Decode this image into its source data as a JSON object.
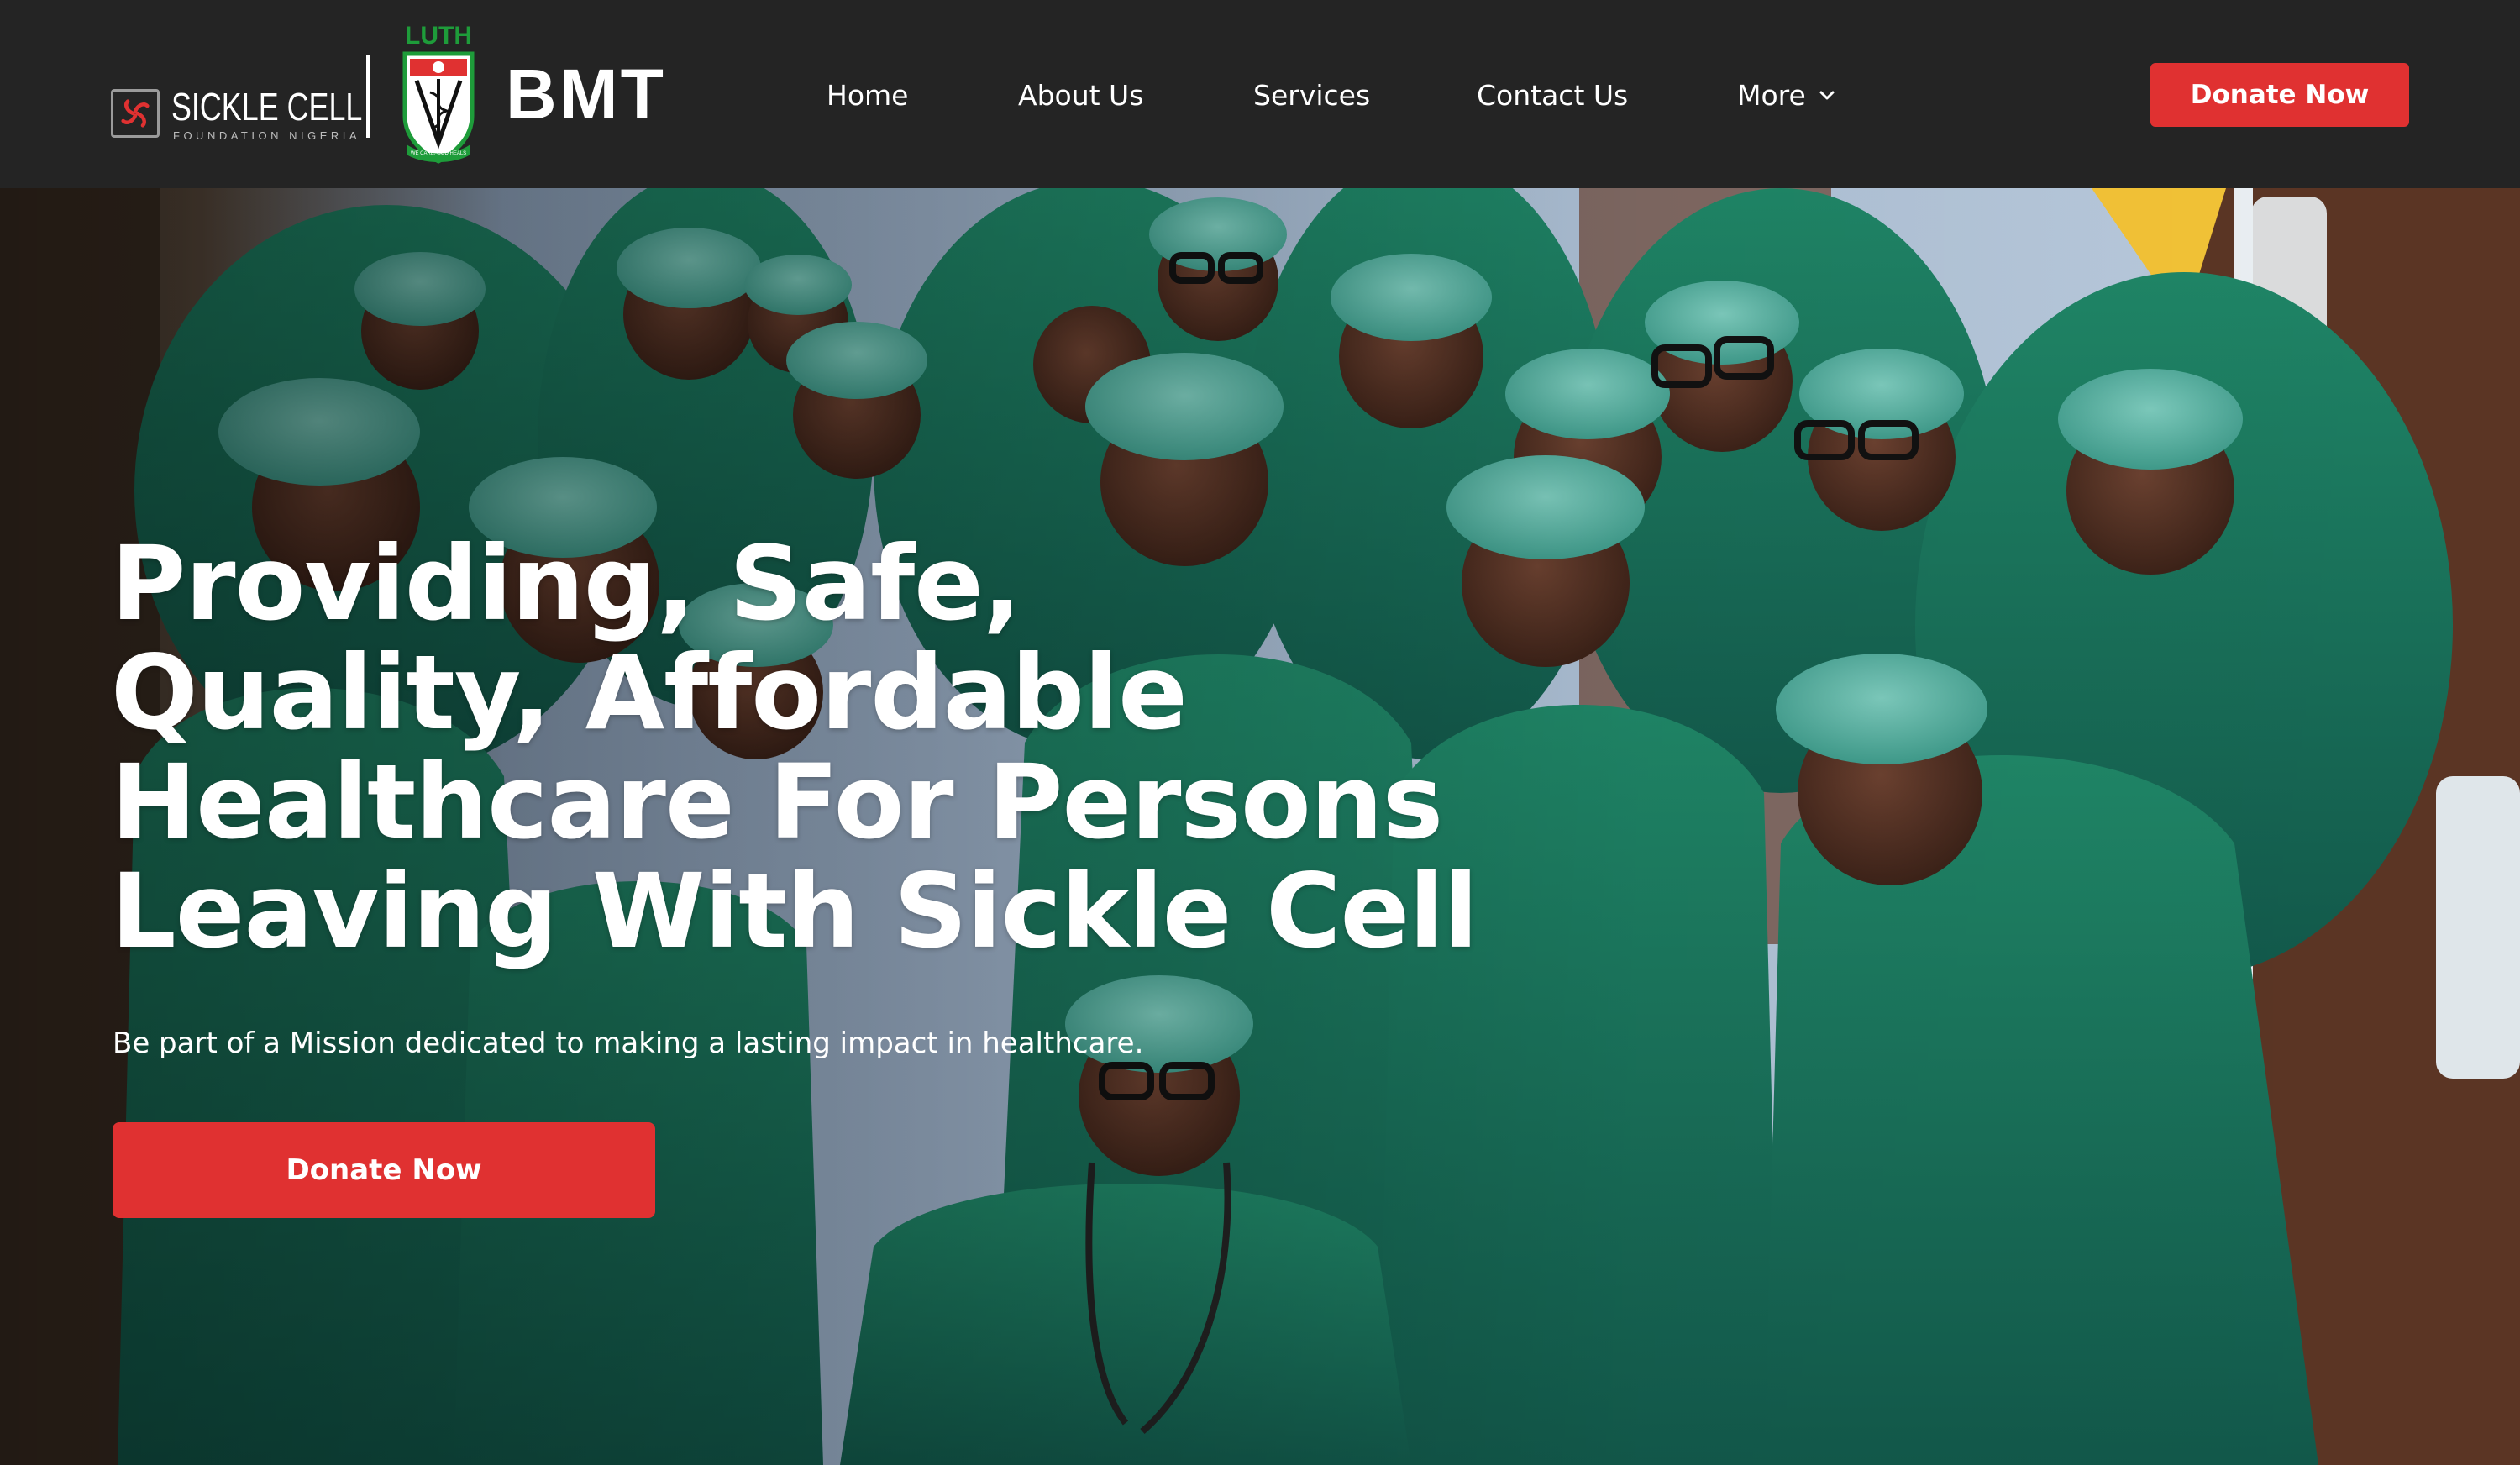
{
  "brand": {
    "org_name": "SICKLE CELL",
    "org_subtitle": "FOUNDATION NIGERIA",
    "partner_name": "LUTH",
    "partner_motto": "WE CARE, GOD HEALS",
    "product_name": "BMT"
  },
  "nav": {
    "items": [
      {
        "label": "Home"
      },
      {
        "label": "About Us"
      },
      {
        "label": "Services"
      },
      {
        "label": "Contact Us"
      },
      {
        "label": "More"
      }
    ]
  },
  "header": {
    "donate_label": "Donate Now"
  },
  "hero": {
    "title": "Providing, Safe, Quality, Affordable Healthcare For Persons Leaving With Sickle Cell",
    "subtitle": "Be part of a Mission dedicated to making a lasting impact in healthcare.",
    "cta_label": "Donate Now",
    "photo_icon": "group-photo-medical-staff"
  },
  "colors": {
    "header_bg": "#242424",
    "accent": "#e03131",
    "luth_green": "#1e9c3a",
    "scrubs_green": "#1f7a5c",
    "cap_teal": "#5fb8a8",
    "text_light": "#ffffff"
  }
}
